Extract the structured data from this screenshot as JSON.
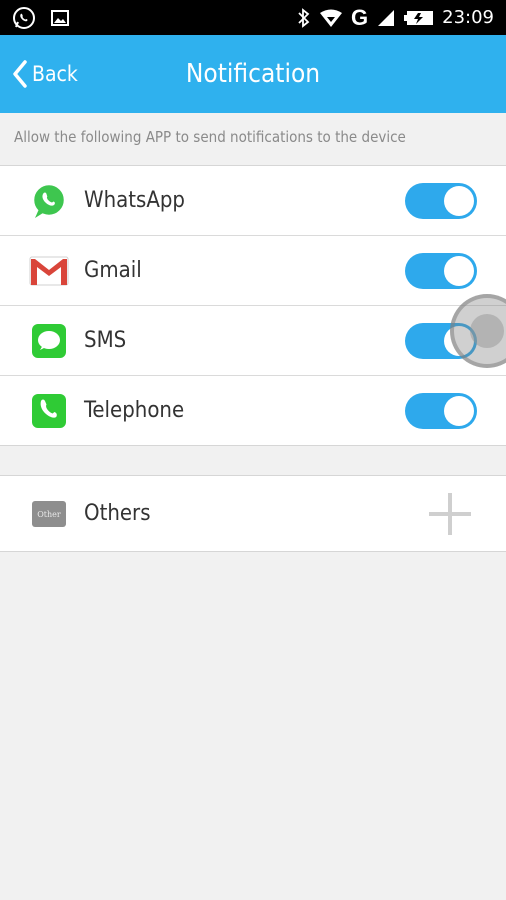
{
  "status_bar": {
    "time": "23:09",
    "network_type": "G",
    "icons": [
      "whatsapp-icon",
      "image-icon",
      "bluetooth-icon",
      "wifi-icon",
      "signal-icon",
      "battery-icon"
    ]
  },
  "header": {
    "back_label": "Back",
    "title": "Notification",
    "color": "#2fb1ee"
  },
  "subtitle": "Allow the following APP to send notifications to the device",
  "apps": [
    {
      "label": "WhatsApp",
      "icon": "whatsapp-icon",
      "enabled": true
    },
    {
      "label": "Gmail",
      "icon": "gmail-icon",
      "enabled": true
    },
    {
      "label": "SMS",
      "icon": "sms-icon",
      "enabled": true
    },
    {
      "label": "Telephone",
      "icon": "telephone-icon",
      "enabled": true
    }
  ],
  "others": {
    "label": "Others",
    "icon_text": "Other",
    "add_icon": "plus-icon"
  },
  "colors": {
    "toggle_on": "#2ea9ec",
    "background": "#f1f1f1"
  }
}
